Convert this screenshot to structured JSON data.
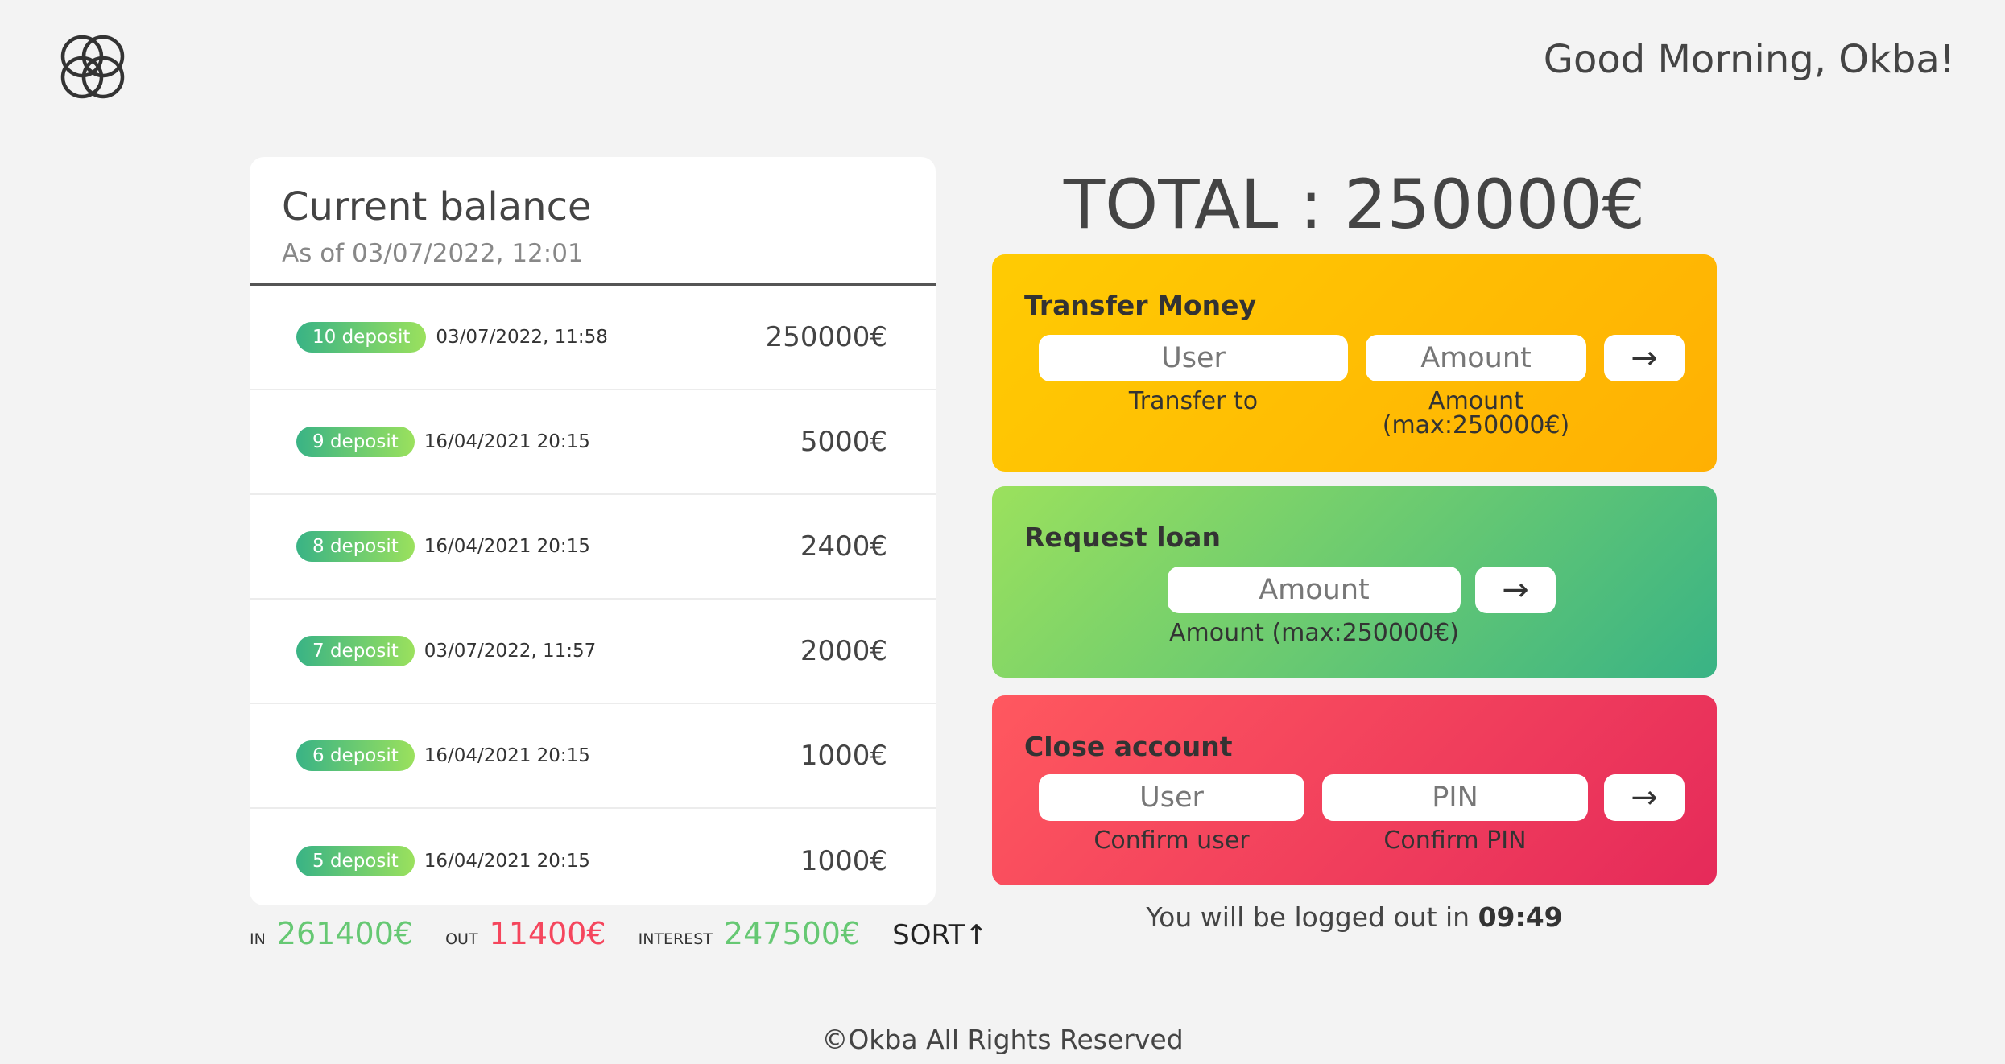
{
  "header": {
    "greeting": "Good Morning, Okba!",
    "logo_icon": "overlapping-circles-logo-icon"
  },
  "balance": {
    "title": "Current balance",
    "date": "As of 03/07/2022, 12:01"
  },
  "movements": [
    {
      "badge": "10 deposit",
      "date": "03/07/2022, 11:58",
      "value": "250000€"
    },
    {
      "badge": "9 deposit",
      "date": "16/04/2021 20:15",
      "value": "5000€"
    },
    {
      "badge": "8 deposit",
      "date": "16/04/2021 20:15",
      "value": "2400€"
    },
    {
      "badge": "7 deposit",
      "date": "03/07/2022, 11:57",
      "value": "2000€"
    },
    {
      "badge": "6 deposit",
      "date": "16/04/2021 20:15",
      "value": "1000€"
    },
    {
      "badge": "5 deposit",
      "date": "16/04/2021 20:15",
      "value": "1000€"
    }
  ],
  "summary": {
    "in_label": "IN",
    "in_value": "261400€",
    "out_label": "OUT",
    "out_value": "11400€",
    "interest_label": "INTEREST",
    "interest_value": "247500€",
    "sort_label": "SORT↑"
  },
  "total": "TOTAL : 250000€",
  "transfer": {
    "title": "Transfer Money",
    "user_placeholder": "User",
    "amount_placeholder": "Amount",
    "user_label": "Transfer to",
    "amount_label_1": "Amount",
    "amount_label_2": "(max:250000€)",
    "button": "→"
  },
  "loan": {
    "title": "Request loan",
    "amount_placeholder": "Amount",
    "amount_label": "Amount (max:250000€)",
    "button": "→"
  },
  "close": {
    "title": "Close account",
    "user_placeholder": "User",
    "pin_placeholder": "PIN",
    "user_label": "Confirm user",
    "pin_label": "Confirm PIN",
    "button": "→"
  },
  "timer": {
    "text": "You will be logged out in ",
    "time": "09:49"
  },
  "footer": "©Okba All Rights Reserved",
  "colors": {
    "transfer_start": "#ffcb03",
    "transfer_end": "#ffb003",
    "loan_start": "#9be15d",
    "loan_end": "#39b385",
    "close_start": "#ff585f",
    "close_end": "#e52a5a",
    "in": "#66c873",
    "out": "#f5465d"
  }
}
